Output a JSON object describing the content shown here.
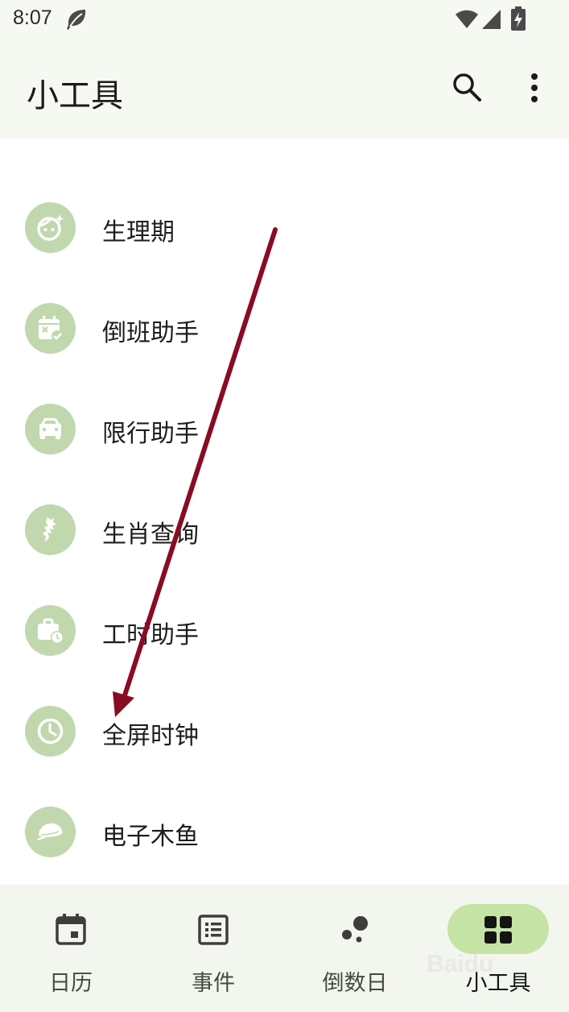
{
  "status_bar": {
    "time": "8:07",
    "icons": [
      "leaf-icon",
      "wifi-icon",
      "signal-icon",
      "battery-charging-icon"
    ]
  },
  "app_bar": {
    "title": "小工具",
    "actions": [
      "search-icon",
      "more-vert-icon"
    ]
  },
  "tools": [
    {
      "label": "生理期",
      "icon": "face-sparkle-icon"
    },
    {
      "label": "倒班助手",
      "icon": "calendar-check-icon"
    },
    {
      "label": "限行助手",
      "icon": "car-icon"
    },
    {
      "label": "生肖查询",
      "icon": "dragon-icon"
    },
    {
      "label": "工时助手",
      "icon": "briefcase-clock-icon"
    },
    {
      "label": "全屏时钟",
      "icon": "clock-icon"
    },
    {
      "label": "电子木鱼",
      "icon": "wooden-fish-icon"
    }
  ],
  "bottom_nav": [
    {
      "label": "日历",
      "icon": "calendar-icon",
      "active": false
    },
    {
      "label": "事件",
      "icon": "list-icon",
      "active": false
    },
    {
      "label": "倒数日",
      "icon": "bubbles-icon",
      "active": false
    },
    {
      "label": "小工具",
      "icon": "grid-icon",
      "active": true
    }
  ],
  "annotation": {
    "color": "#8a0b22"
  },
  "watermark": "Baidu",
  "colors": {
    "icon_bg": "#c1d8ae",
    "nav_pill": "#c6e3a6",
    "bar_bg": "#f6f8f2"
  }
}
